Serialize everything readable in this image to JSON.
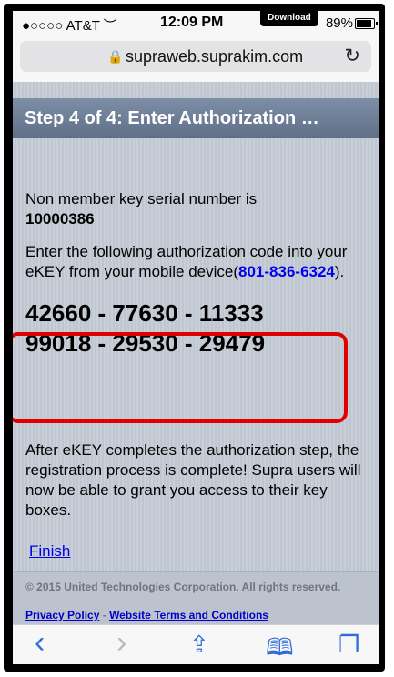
{
  "status": {
    "carrier": "●○○○○ AT&T",
    "wifi": "wifi",
    "time": "12:09 PM",
    "download_badge": "Download",
    "battery": "89%"
  },
  "browser": {
    "url": "supraweb.suprakim.com",
    "lock_icon": "lock-icon",
    "reload_icon": "reload-icon"
  },
  "page": {
    "header_title": "Step 4 of 4: Enter Authorization …",
    "serial_label": "Non member key serial number is",
    "serial_value": "10000386",
    "instruction_before": "Enter the following authorization code into your eKEY from your mobile device(",
    "phone_link": "801-836-6324",
    "instruction_after": ").",
    "code_line1": "42660 - 77630 - 11333",
    "code_line2": "99018 - 29530 - 29479",
    "after_text": "After eKEY completes the authorization step, the registration process is complete! Supra users will now be able to grant you access to their key boxes.",
    "finish_link": "Finish"
  },
  "footer": {
    "copyright": "© 2015 United Technologies Corporation. All rights reserved.",
    "privacy_link": "Privacy Policy",
    "separator": " - ",
    "terms_link": "Website Terms and Conditions"
  },
  "toolbar": {
    "back": "‹",
    "forward": "›",
    "share": "⇪",
    "bookmarks": "🕮",
    "tabs": "❐"
  },
  "colors": {
    "header_bg": "#6f7f98",
    "link": "#0000ee",
    "highlight": "#e00000",
    "toolbar_accent": "#2f6ed8"
  }
}
